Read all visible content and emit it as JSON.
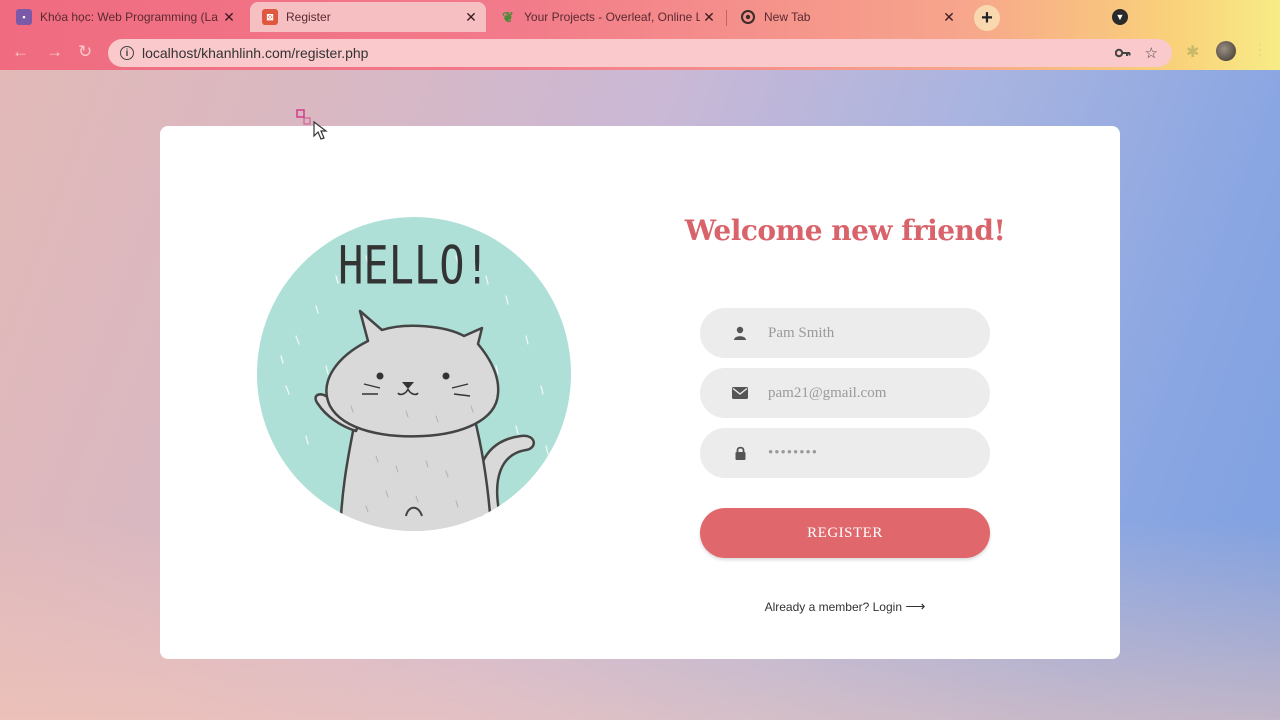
{
  "browser": {
    "tabs": [
      {
        "title": "Khóa học: Web Programming (La",
        "favicon": "course-favicon",
        "active": false
      },
      {
        "title": "Register",
        "favicon": "xampp-favicon",
        "active": true
      },
      {
        "title": "Your Projects - Overleaf, Online L",
        "favicon": "overleaf-favicon",
        "active": false
      },
      {
        "title": "New Tab",
        "favicon": "chrome-favicon",
        "active": false
      }
    ],
    "new_tab_label": "+",
    "url": "localhost/khanhlinh.com/register.php",
    "icons": [
      "back-icon",
      "forward-icon",
      "reload-icon",
      "site-info-icon",
      "key-icon",
      "star-icon",
      "extensions-icon",
      "profile-avatar",
      "menu-icon"
    ]
  },
  "form": {
    "heading": "Welcome new friend!",
    "name_placeholder": "Pam Smith",
    "email_placeholder": "pam21@gmail.com",
    "password_placeholder": "••••••••",
    "register_label": "REGISTER",
    "login_text": "Already a member? Login",
    "login_arrow": "⟶"
  },
  "illustration": {
    "text": "HELLO!",
    "bg_color": "#aee0d8",
    "cat_color": "#d9d9d9"
  },
  "colors": {
    "accent": "#e0676c",
    "heading": "#d9636a",
    "field_bg": "#ececec"
  }
}
